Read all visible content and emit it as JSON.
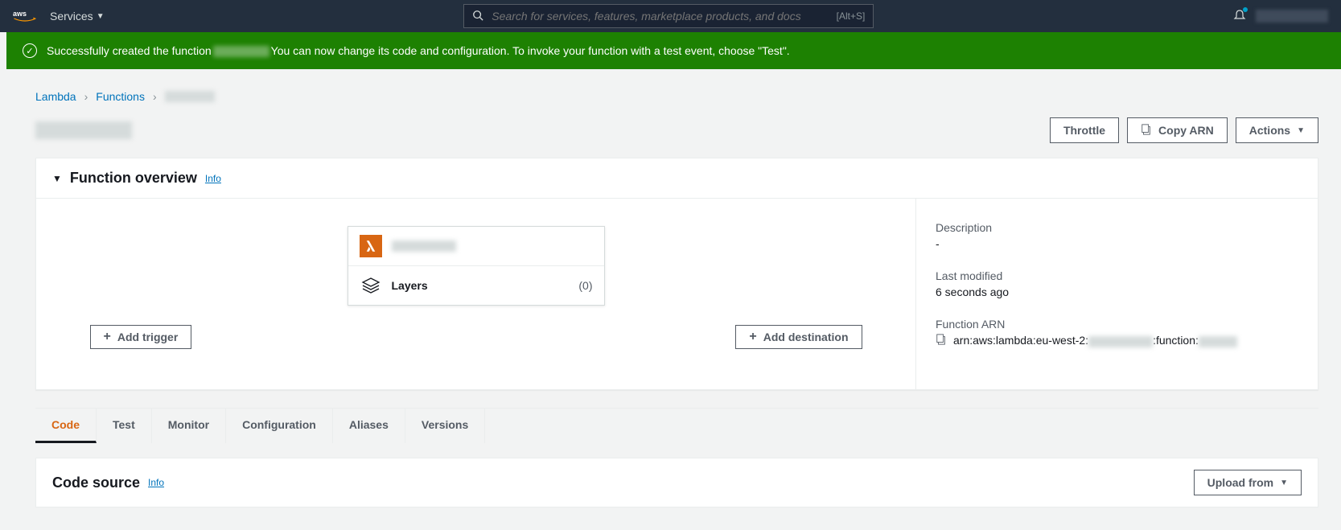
{
  "nav": {
    "services_label": "Services",
    "search_placeholder": "Search for services, features, marketplace products, and docs",
    "search_shortcut": "[Alt+S]"
  },
  "banner": {
    "prefix": "Successfully created the function",
    "suffix": "You can now change its code and configuration. To invoke your function with a test event, choose \"Test\"."
  },
  "breadcrumbs": {
    "root": "Lambda",
    "functions": "Functions"
  },
  "buttons": {
    "throttle": "Throttle",
    "copy_arn": "Copy ARN",
    "actions": "Actions",
    "add_trigger": "Add trigger",
    "add_destination": "Add destination",
    "upload_from": "Upload from"
  },
  "overview": {
    "title": "Function overview",
    "info": "Info",
    "layers_label": "Layers",
    "layers_count": "(0)",
    "desc_label": "Description",
    "desc_value": "-",
    "mod_label": "Last modified",
    "mod_value": "6 seconds ago",
    "arn_label": "Function ARN",
    "arn_prefix": "arn:aws:lambda:eu-west-2:",
    "arn_mid": ":function:"
  },
  "tabs": [
    "Code",
    "Test",
    "Monitor",
    "Configuration",
    "Aliases",
    "Versions"
  ],
  "code_source": {
    "title": "Code source",
    "info": "Info"
  }
}
